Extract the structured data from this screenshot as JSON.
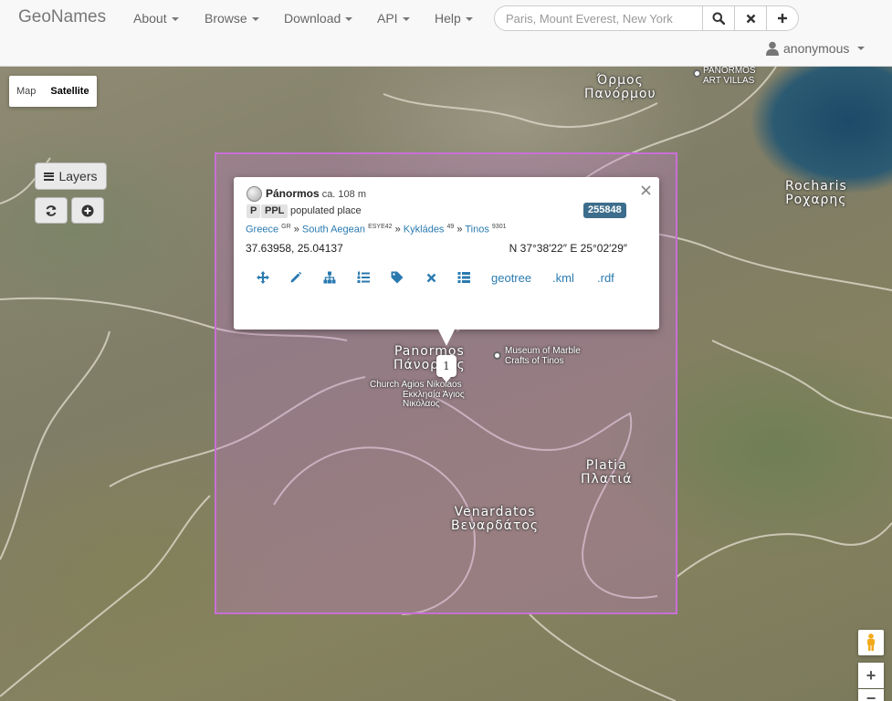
{
  "navbar": {
    "brand": "GeoNames",
    "menu": [
      {
        "label": "About"
      },
      {
        "label": "Browse"
      },
      {
        "label": "Download"
      },
      {
        "label": "API"
      },
      {
        "label": "Help"
      }
    ],
    "search_placeholder": "Paris, Mount Everest, New York",
    "search_value": "",
    "search_icon": "search-icon",
    "clear_icon": "close-icon",
    "add_icon": "plus-icon",
    "user_label": "anonymous",
    "user_icon": "user-icon"
  },
  "map_controls": {
    "map_label": "Map",
    "satellite_label": "Satellite",
    "active_type": "Satellite",
    "layers_label": "Layers",
    "refresh_icon": "refresh-icon",
    "add_circle_icon": "plus-circle-icon",
    "pegman_icon": "pegman-icon",
    "zoom_in_label": "+",
    "zoom_out_label": "−"
  },
  "map_labels": {
    "panormos_bay_el": "Όρμος",
    "panormos_bay_el2": "Πανόρμου",
    "panormos_art_villas": "PANORMOS ART VILLAS",
    "rocharis": "Rocharis",
    "rocharis_el": "Ροχαρης",
    "panormos": "Panormos",
    "panormos_el": "Πάνορμος",
    "museum": "Museum of Marble Crafts of Tinos",
    "church": "Church Agios Nikolaos",
    "church_el": "Εκκλησία Άγιος Νικόλαος",
    "platia": "Platia",
    "platia_el": "Πλατιά",
    "venardatos": "Venardatos",
    "venardatos_el": "Βεναρδάτος"
  },
  "cluster_count": "1",
  "popup": {
    "name": "Pánormos",
    "population": "ca. 108 m",
    "feature_class": "P",
    "feature_code": "PPL",
    "feature_type": "populated place",
    "geonameid": "255848",
    "breadcrumb": [
      {
        "label": "Greece",
        "sup": "GR"
      },
      {
        "label": "South Aegean",
        "sup": "ESYE42"
      },
      {
        "label": "Kykládes",
        "sup": "49"
      },
      {
        "label": "Tinos",
        "sup": "9301"
      }
    ],
    "separator": "»",
    "coords": "37.63958, 25.04137",
    "dms": "N 37°38′22″ E 25°02′29″",
    "close_icon": "close-icon",
    "icons": [
      "move-icon",
      "edit-icon",
      "hierarchy-icon",
      "list-numbered-icon",
      "tag-icon",
      "delete-icon",
      "list-icon"
    ],
    "links": [
      "geotree",
      ".kml",
      ".rdf"
    ]
  },
  "colors": {
    "link": "#2a7ab0",
    "badge": "#3c6d8c",
    "bbox": "#c86fd6"
  }
}
